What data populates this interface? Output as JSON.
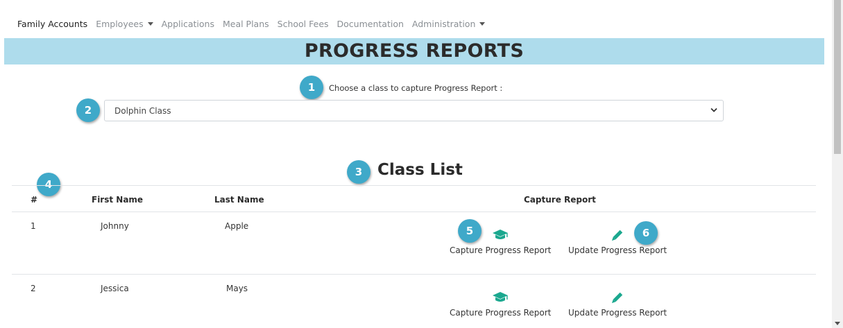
{
  "nav": {
    "items": [
      {
        "label": "Family Accounts",
        "active": true,
        "dropdown": false
      },
      {
        "label": "Employees",
        "active": false,
        "dropdown": true
      },
      {
        "label": "Applications",
        "active": false,
        "dropdown": false
      },
      {
        "label": "Meal Plans",
        "active": false,
        "dropdown": false
      },
      {
        "label": "School Fees",
        "active": false,
        "dropdown": false
      },
      {
        "label": "Documentation",
        "active": false,
        "dropdown": false
      },
      {
        "label": "Administration",
        "active": false,
        "dropdown": true
      }
    ]
  },
  "page": {
    "title": "PROGRESS REPORTS"
  },
  "class_selector": {
    "label": "Choose a class to capture Progress Report :",
    "selected": "Dolphin Class"
  },
  "class_list": {
    "title": "Class List",
    "headers": {
      "number": "#",
      "first_name": "First Name",
      "last_name": "Last Name",
      "capture_report": "Capture Report"
    },
    "rows": [
      {
        "number": "1",
        "first_name": "Johnny",
        "last_name": "Apple",
        "capture_label": "Capture Progress Report",
        "update_label": "Update Progress Report"
      },
      {
        "number": "2",
        "first_name": "Jessica",
        "last_name": "Mays",
        "capture_label": "Capture Progress Report",
        "update_label": "Update Progress Report"
      }
    ]
  },
  "badges": {
    "b1": "1",
    "b2": "2",
    "b3": "3",
    "b4": "4",
    "b5": "5",
    "b6": "6"
  },
  "colors": {
    "banner": "#aedcec",
    "badge": "#3fa9c9",
    "action_icon": "#1ba88f"
  },
  "icons": {
    "capture": "graduation-cap-icon",
    "update": "pencil-icon",
    "select": "chevron-down-icon"
  }
}
